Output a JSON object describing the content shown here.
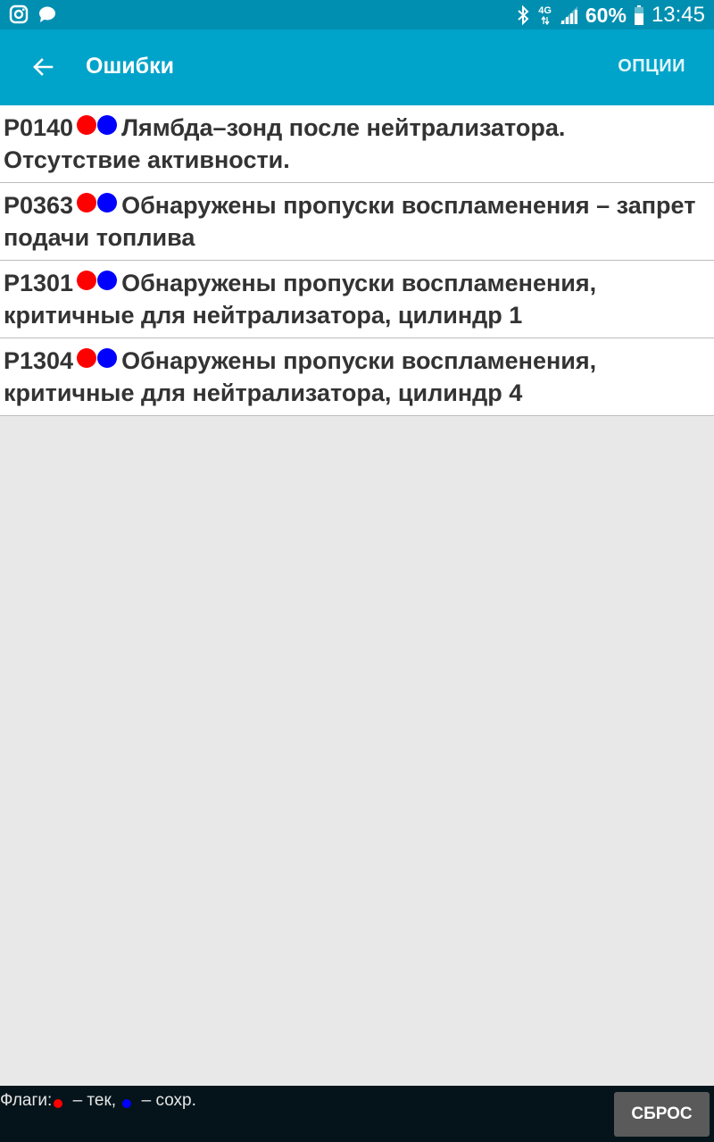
{
  "status_bar": {
    "icons_left": [
      "instagram-icon",
      "chat-bubble-icon"
    ],
    "network": "4G",
    "battery": "60%",
    "time": "13:45"
  },
  "app_bar": {
    "title": "Ошибки",
    "options_label": "ОПЦИИ"
  },
  "errors": [
    {
      "code": "P0140",
      "description": "Лямбда–зонд после нейтрализатора. Отсутствие активности."
    },
    {
      "code": "P0363",
      "description": "Обнаружены пропуски воспламенения – запрет подачи топлива"
    },
    {
      "code": "P1301",
      "description": "Обнаружены пропуски воспламенения, критичные для нейтрализатора, цилиндр 1"
    },
    {
      "code": "P1304",
      "description": "Обнаружены пропуски воспламенения, критичные для нейтрализатора, цилиндр 4"
    }
  ],
  "footer": {
    "legend_prefix": "Флаги:",
    "legend_current": " – тек, ",
    "legend_saved": " – сохр.",
    "reset_label": "СБРОС"
  },
  "colors": {
    "flag_current": "#ff0000",
    "flag_saved": "#0000ff",
    "app_bar": "#00a3c9",
    "status_bar": "#008fb0"
  }
}
